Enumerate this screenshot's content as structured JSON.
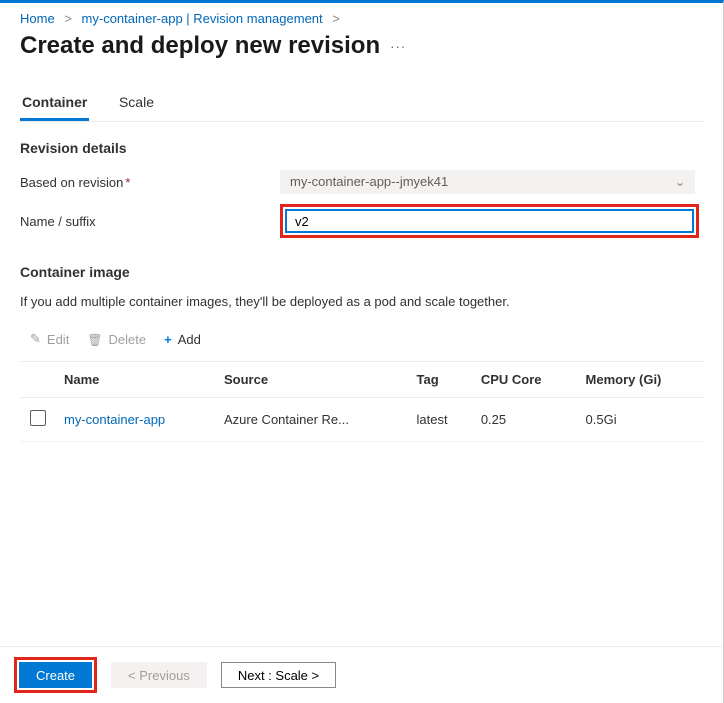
{
  "breadcrumb": {
    "items": [
      {
        "label": "Home"
      },
      {
        "label": "my-container-app | Revision management"
      }
    ]
  },
  "page": {
    "title": "Create and deploy new revision"
  },
  "tabs": {
    "container": "Container",
    "scale": "Scale"
  },
  "revision_details": {
    "section_title": "Revision details",
    "based_on_label": "Based on revision",
    "based_on_value": "my-container-app--jmyek41",
    "name_label": "Name / suffix",
    "name_value": "v2"
  },
  "container_image": {
    "section_title": "Container image",
    "description": "If you add multiple container images, they'll be deployed as a pod and scale together.",
    "toolbar": {
      "edit": "Edit",
      "delete": "Delete",
      "add": "Add"
    },
    "columns": {
      "name": "Name",
      "source": "Source",
      "tag": "Tag",
      "cpu": "CPU Core",
      "memory": "Memory (Gi)"
    },
    "rows": [
      {
        "name": "my-container-app",
        "source": "Azure Container Re...",
        "tag": "latest",
        "cpu": "0.25",
        "memory": "0.5Gi"
      }
    ]
  },
  "footer": {
    "create": "Create",
    "previous": "< Previous",
    "next": "Next : Scale >"
  }
}
